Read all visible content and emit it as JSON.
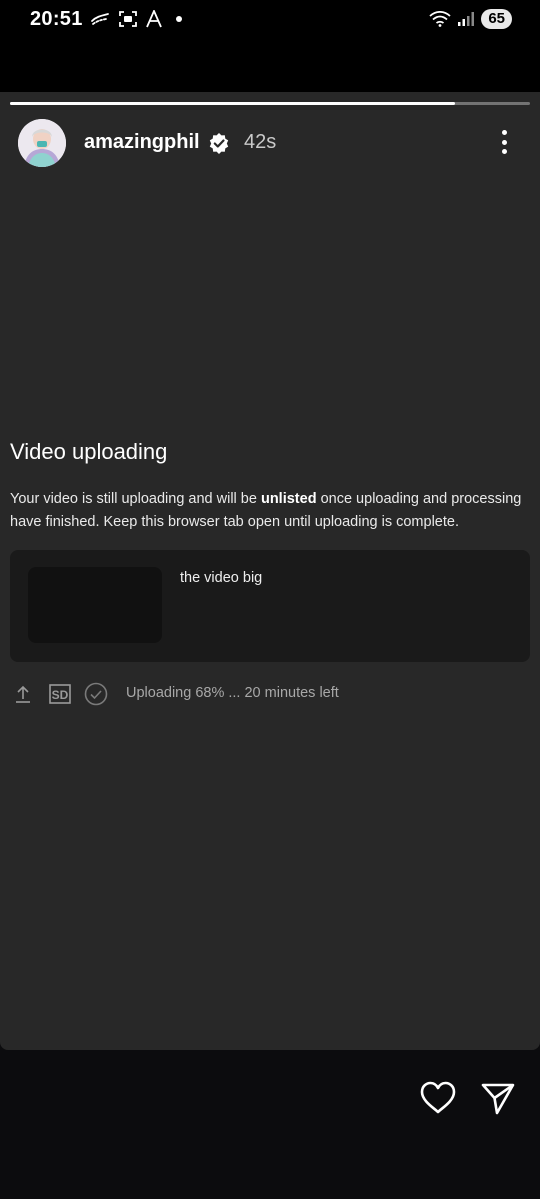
{
  "status_bar": {
    "time": "20:51",
    "battery": "65",
    "icons_left": [
      "hand-wave-icon",
      "screenshot-icon",
      "font-icon",
      "notification-dot-icon"
    ],
    "icons_right": [
      "wifi-icon",
      "signal-icon"
    ]
  },
  "story": {
    "progress": 0.855,
    "username": "amazingphil",
    "verified": true,
    "time_ago": "42s",
    "more_icon": "more-vertical-icon"
  },
  "content": {
    "heading": "Video uploading",
    "desc_before": "Your video is still uploading and will be ",
    "desc_bold": "unlisted",
    "desc_after": " once uploading and processing have finished. Keep this browser tab open until uploading is complete.",
    "video_title": "the video big",
    "status_icons": [
      "upload-icon",
      "sd-icon",
      "check-circle-icon"
    ],
    "upload_status": "Uploading 68% ... 20 minutes left"
  },
  "actions": {
    "like_icon": "heart-icon",
    "share_icon": "send-icon"
  }
}
